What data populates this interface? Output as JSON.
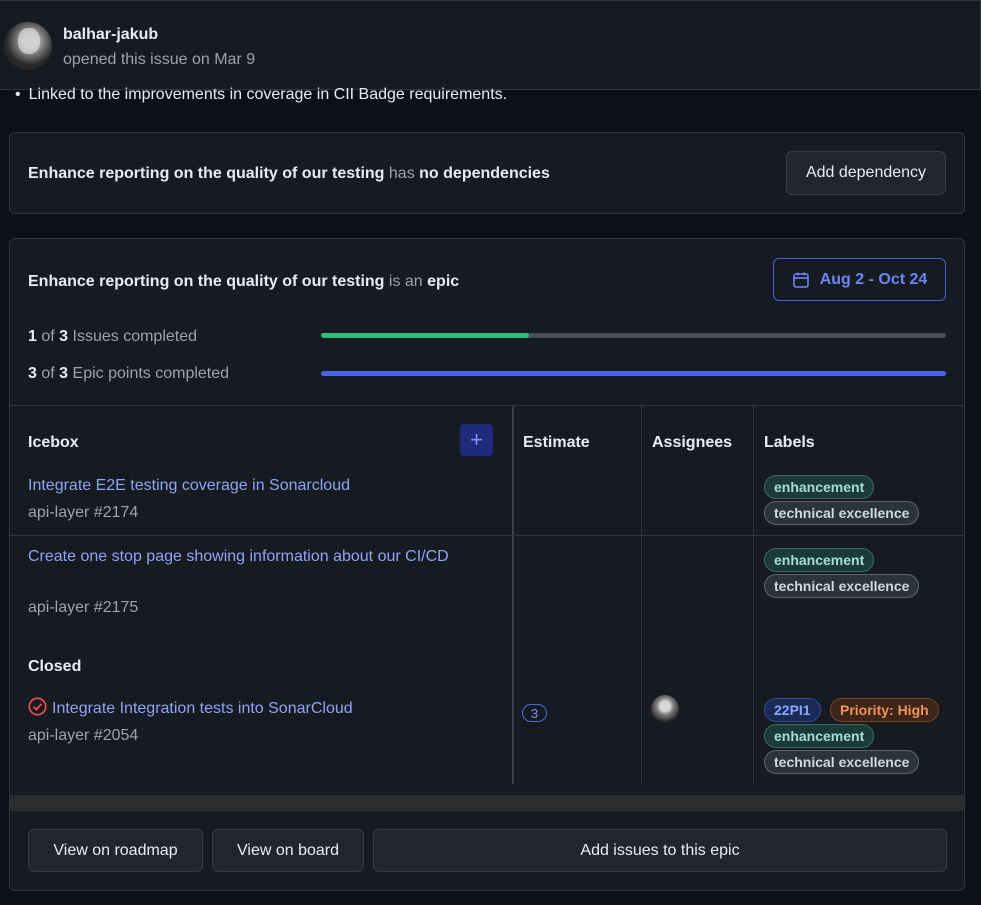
{
  "header": {
    "author": "balhar-jakub",
    "opened_text": "opened this issue on Mar 9"
  },
  "bullet_text": "Linked to the improvements in coverage in CII Badge requirements.",
  "dependencies": {
    "issue_title": "Enhance reporting on the quality of our testing",
    "has_text": "has",
    "status": "no dependencies",
    "button_label": "Add dependency"
  },
  "epic": {
    "issue_title": "Enhance reporting on the quality of our testing",
    "is_an_text": "is an",
    "epic_word": "epic",
    "date_range": "Aug 2 - Oct 24",
    "issues_progress": {
      "done": "1",
      "of": "of",
      "total": "3",
      "label": "Issues completed",
      "fraction": 0.333,
      "color": "#2cbe7d"
    },
    "points_progress": {
      "done": "3",
      "of": "of",
      "total": "3",
      "label": "Epic points completed",
      "fraction": 1.0,
      "color": "#4a63e8"
    },
    "columns": {
      "icebox": "Icebox",
      "estimate": "Estimate",
      "assignees": "Assignees",
      "labels": "Labels"
    },
    "add_button_label": "+",
    "rows": [
      {
        "title": "Integrate E2E testing coverage in Sonarcloud",
        "ref": "api-layer #2174",
        "labels": [
          "enhancement",
          "technical excellence"
        ]
      },
      {
        "title": "Create one stop page showing information about our CI/CD",
        "ref": "api-layer #2175",
        "labels": [
          "enhancement",
          "technical excellence"
        ]
      }
    ],
    "closed_heading": "Closed",
    "closed_row": {
      "title": "Integrate Integration tests into SonarCloud",
      "ref": "api-layer #2054",
      "estimate": "3",
      "labels": [
        "22PI1",
        "Priority: High",
        "enhancement",
        "technical excellence"
      ]
    },
    "footer": {
      "roadmap": "View on roadmap",
      "board": "View on board",
      "add_issues": "Add issues to this epic"
    }
  }
}
